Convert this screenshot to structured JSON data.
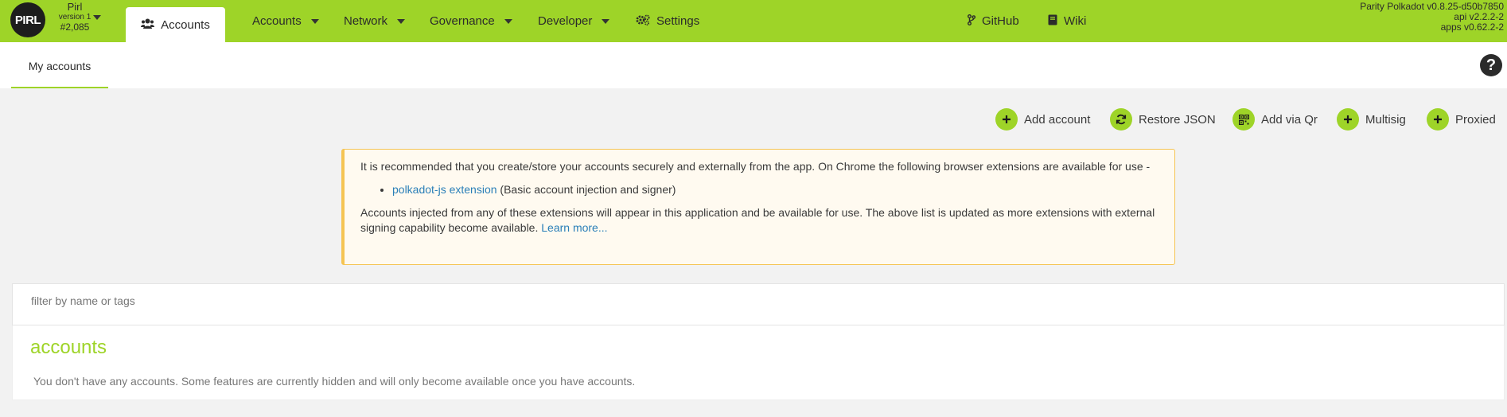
{
  "chain": {
    "logo_text": "PIRL",
    "name": "Pirl",
    "version": "version 1",
    "block": "#2,085"
  },
  "nav": {
    "active_tab": "Accounts",
    "items": [
      {
        "label": "Accounts",
        "dropdown": true
      },
      {
        "label": "Network",
        "dropdown": true
      },
      {
        "label": "Governance",
        "dropdown": true
      },
      {
        "label": "Developer",
        "dropdown": true
      },
      {
        "label": "Settings",
        "dropdown": false
      }
    ],
    "links": [
      {
        "label": "GitHub"
      },
      {
        "label": "Wiki"
      }
    ]
  },
  "versions": {
    "node": "Parity Polkadot v0.8.25-d50b7850",
    "api": "api v2.2.2-2",
    "apps": "apps v0.62.2-2"
  },
  "subnav": {
    "tab": "My accounts",
    "help": "?"
  },
  "actions": [
    {
      "label": "Add account",
      "icon": "plus-icon"
    },
    {
      "label": "Restore JSON",
      "icon": "sync-icon"
    },
    {
      "label": "Add via Qr",
      "icon": "qrcode-icon"
    },
    {
      "label": "Multisig",
      "icon": "plus-icon"
    },
    {
      "label": "Proxied",
      "icon": "plus-icon"
    }
  ],
  "warning": {
    "intro": "It is recommended that you create/store your accounts securely and externally from the app. On Chrome the following browser extensions are available for use -",
    "ext_link": "polkadot-js extension",
    "ext_desc": " (Basic account injection and signer)",
    "outro": "Accounts injected from any of these extensions will appear in this application and be available for use. The above list is updated as more extensions with external signing capability become available.",
    "learn_more": "Learn more..."
  },
  "filter": {
    "placeholder": "filter by name or tags",
    "value": ""
  },
  "accounts": {
    "title": "accounts",
    "empty_message": "You don't have any accounts. Some features are currently hidden and will only become available once you have accounts."
  },
  "colors": {
    "brand": "#9ed428",
    "warning_border": "#f5c453",
    "link": "#2a7fb8"
  }
}
